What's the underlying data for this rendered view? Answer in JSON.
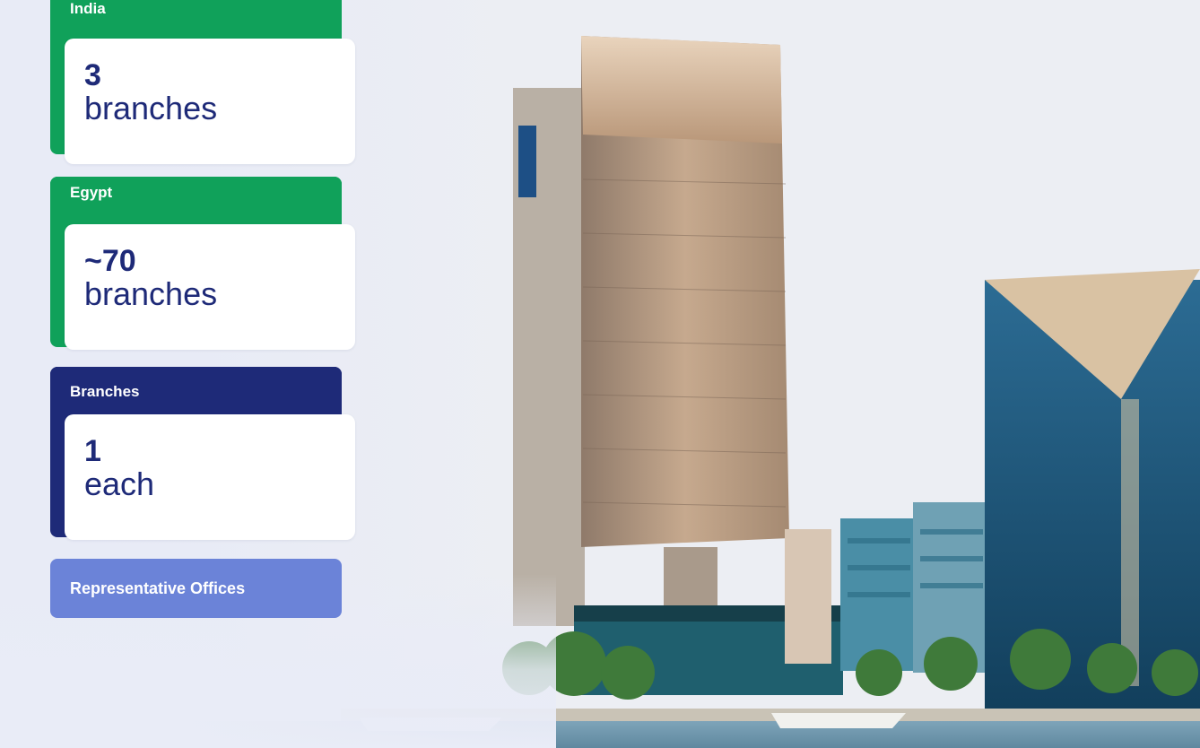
{
  "regions": [
    {
      "tab_label": "India",
      "count": "3",
      "unit": "branches",
      "color": "#10a15a"
    },
    {
      "tab_label": "Egypt",
      "count": "~70",
      "unit": "branches",
      "color": "#10a15a"
    },
    {
      "tab_label": "Branches",
      "count": "1",
      "unit": "each",
      "color": "#1e2a78"
    }
  ],
  "representative_offices": {
    "label": "Representative Offices",
    "color": "#6b83d8"
  },
  "colors": {
    "green_accent": "#10a15a",
    "navy_accent": "#1e2a78",
    "light_blue_accent": "#6b83d8",
    "card_text": "#1e2a78"
  },
  "icons": [
    "bank-tower-photo"
  ]
}
